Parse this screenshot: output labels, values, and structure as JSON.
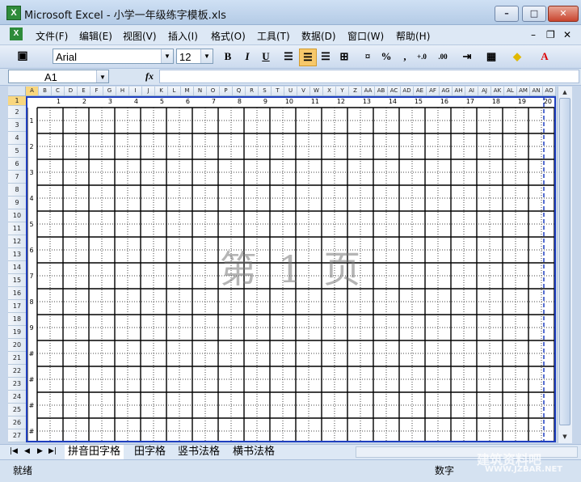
{
  "window": {
    "title": "Microsoft Excel - 小学一年级练字模板.xls",
    "app_icon": "X"
  },
  "menu": [
    "文件(F)",
    "编辑(E)",
    "视图(V)",
    "插入(I)",
    "格式(O)",
    "工具(T)",
    "数据(D)",
    "窗口(W)",
    "帮助(H)"
  ],
  "toolbar": {
    "font_name": "Arial",
    "font_size": "12",
    "bold": "B",
    "italic": "I",
    "underline": "U",
    "percent": "%",
    "comma": ",",
    "inc_decimal": "+.0",
    "dec_decimal": ".00"
  },
  "formula": {
    "cell_ref": "A1",
    "fx": "fx"
  },
  "columns": [
    "A",
    "B",
    "C",
    "D",
    "E",
    "F",
    "G",
    "H",
    "I",
    "J",
    "K",
    "L",
    "M",
    "N",
    "O",
    "P",
    "Q",
    "R",
    "S",
    "T",
    "U",
    "V",
    "W",
    "X",
    "Y",
    "Z",
    "AA",
    "AB",
    "AC",
    "AD",
    "AE",
    "AF",
    "AG",
    "AH",
    "AI",
    "AJ",
    "AK",
    "AL",
    "AM",
    "AN",
    "AO"
  ],
  "rows": [
    "1",
    "2",
    "3",
    "4",
    "5",
    "6",
    "7",
    "8",
    "9",
    "10",
    "11",
    "12",
    "13",
    "14",
    "15",
    "16",
    "17",
    "18",
    "19",
    "20",
    "21",
    "22",
    "23",
    "24",
    "25",
    "26",
    "27"
  ],
  "grid_col_numbers": [
    "1",
    "2",
    "3",
    "4",
    "5",
    "6",
    "7",
    "8",
    "9",
    "10",
    "11",
    "12",
    "13",
    "14",
    "15",
    "16",
    "17",
    "18",
    "19",
    "20"
  ],
  "grid_row_numbers": [
    "1",
    "2",
    "3",
    "4",
    "5",
    "6",
    "7",
    "8",
    "9",
    "#",
    "#",
    "#",
    "#"
  ],
  "page_label": "第 1 页",
  "sheets": [
    "拼音田字格",
    "田字格",
    "竖书法格",
    "横书法格"
  ],
  "status": {
    "ready": "就绪",
    "mode": "数字"
  },
  "watermark": {
    "text": "建筑资料吧",
    "url": "WWW.JZBAR.NET"
  }
}
